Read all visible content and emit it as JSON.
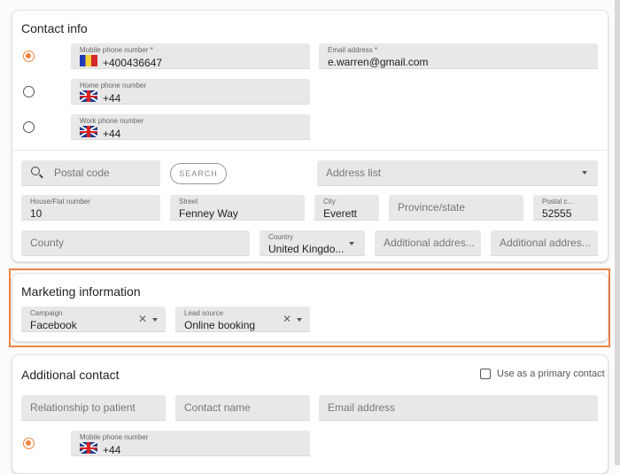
{
  "contact_info": {
    "title": "Contact info",
    "mobile": {
      "label": "Mobile phone number *",
      "value": "+400436647",
      "flag": "romania-flag",
      "selected": true
    },
    "home": {
      "label": "Home phone number",
      "value": "+44",
      "flag": "uk-flag",
      "selected": false
    },
    "work": {
      "label": "Work phone number",
      "value": "+44",
      "flag": "uk-flag",
      "selected": false
    },
    "email": {
      "label": "Email address *",
      "value": "e.warren@gmail.com"
    }
  },
  "address": {
    "postal_search_placeholder": "Postal code",
    "search_button": "SEARCH",
    "address_list_placeholder": "Address list",
    "house": {
      "label": "House/Flat number",
      "value": "10"
    },
    "street": {
      "label": "Street",
      "value": "Fenney Way"
    },
    "city": {
      "label": "City",
      "value": "Everett"
    },
    "province_placeholder": "Province/state",
    "postal": {
      "label": "Postal c...",
      "value": "52555"
    },
    "county_placeholder": "County",
    "country": {
      "label": "Country",
      "value": "United Kingdo..."
    },
    "additional1_placeholder": "Additional addres...",
    "additional2_placeholder": "Additional addres..."
  },
  "marketing": {
    "title": "Marketing information",
    "campaign": {
      "label": "Campaign",
      "value": "Facebook"
    },
    "lead_source": {
      "label": "Lead source",
      "value": "Online booking"
    },
    "highlight_color": "#ec8442"
  },
  "additional_contact": {
    "title": "Additional contact",
    "primary_checkbox_label": "Use as a primary contact",
    "primary_checked": false,
    "relationship_placeholder": "Relationship to patient",
    "contact_name_placeholder": "Contact name",
    "email_placeholder": "Email address",
    "mobile": {
      "label": "Mobile phone number",
      "value": "+44",
      "flag": "uk-flag",
      "selected": true
    }
  }
}
